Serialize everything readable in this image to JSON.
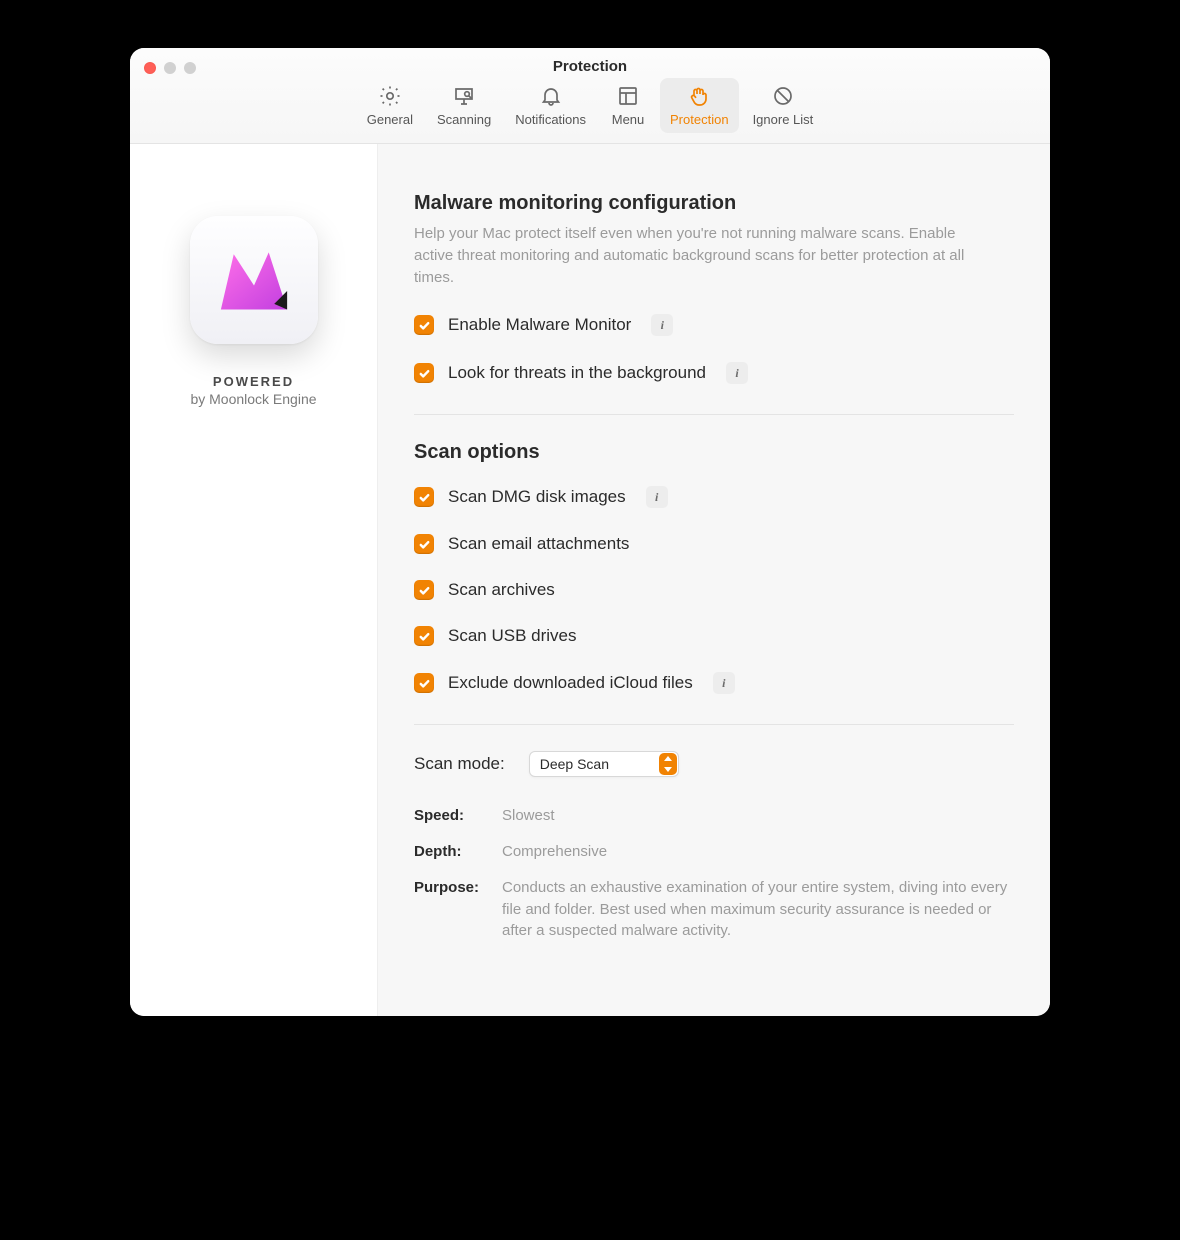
{
  "window": {
    "title": "Protection"
  },
  "toolbar": {
    "items": [
      {
        "id": "general",
        "label": "General"
      },
      {
        "id": "scanning",
        "label": "Scanning"
      },
      {
        "id": "notifications",
        "label": "Notifications"
      },
      {
        "id": "menu",
        "label": "Menu"
      },
      {
        "id": "protection",
        "label": "Protection"
      },
      {
        "id": "ignorelist",
        "label": "Ignore List"
      }
    ],
    "selected": "protection"
  },
  "sidebar": {
    "powered_label": "POWERED",
    "powered_by": "by Moonlock Engine"
  },
  "colors": {
    "accent": "#f18303"
  },
  "section1": {
    "title": "Malware monitoring configuration",
    "desc": "Help your Mac protect itself even when you're not running malware scans. Enable active threat monitoring and automatic background scans for better protection at all times.",
    "options": [
      {
        "label": "Enable Malware Monitor",
        "checked": true,
        "info": true
      },
      {
        "label": "Look for threats in the background",
        "checked": true,
        "info": true
      }
    ]
  },
  "section2": {
    "title": "Scan options",
    "options": [
      {
        "label": "Scan DMG disk images",
        "checked": true,
        "info": true
      },
      {
        "label": "Scan email attachments",
        "checked": true,
        "info": false
      },
      {
        "label": "Scan archives",
        "checked": true,
        "info": false
      },
      {
        "label": "Scan USB drives",
        "checked": true,
        "info": false
      },
      {
        "label": "Exclude downloaded iCloud files",
        "checked": true,
        "info": true
      }
    ]
  },
  "scan_mode": {
    "label": "Scan mode:",
    "value": "Deep Scan",
    "details": {
      "speed": {
        "k": "Speed:",
        "v": "Slowest"
      },
      "depth": {
        "k": "Depth:",
        "v": "Comprehensive"
      },
      "purpose": {
        "k": "Purpose:",
        "v": "Conducts an exhaustive examination of your entire system, diving into every file and folder. Best used when maximum security assurance is needed or after a suspected malware activity."
      }
    }
  }
}
